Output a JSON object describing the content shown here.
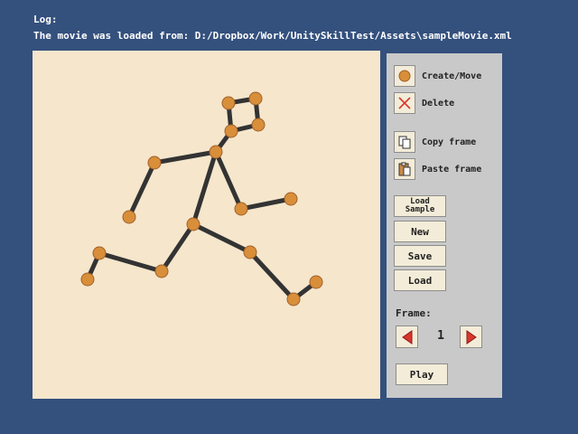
{
  "log": {
    "label": "Log:",
    "message": "The movie was loaded from: D:/Dropbox/Work/UnitySkillTest/Assets\\sampleMovie.xml"
  },
  "tools": {
    "create_move": {
      "label": "Create/Move",
      "icon": "orange-circle-icon"
    },
    "delete": {
      "label": "Delete",
      "icon": "red-x-icon"
    },
    "copy_frame": {
      "label": "Copy frame",
      "icon": "copy-icon"
    },
    "paste_frame": {
      "label": "Paste frame",
      "icon": "clipboard-icon"
    }
  },
  "buttons": {
    "load_sample_line1": "Load",
    "load_sample_line2": "Sample",
    "new": "New",
    "save": "Save",
    "load": "Load",
    "play": "Play"
  },
  "frame": {
    "label": "Frame:",
    "number": "1"
  },
  "colors": {
    "background": "#34507d",
    "canvas": "#f5e6cc",
    "joint": "#d98e3a",
    "bone": "#333333",
    "arrow": "#d9362e"
  }
}
